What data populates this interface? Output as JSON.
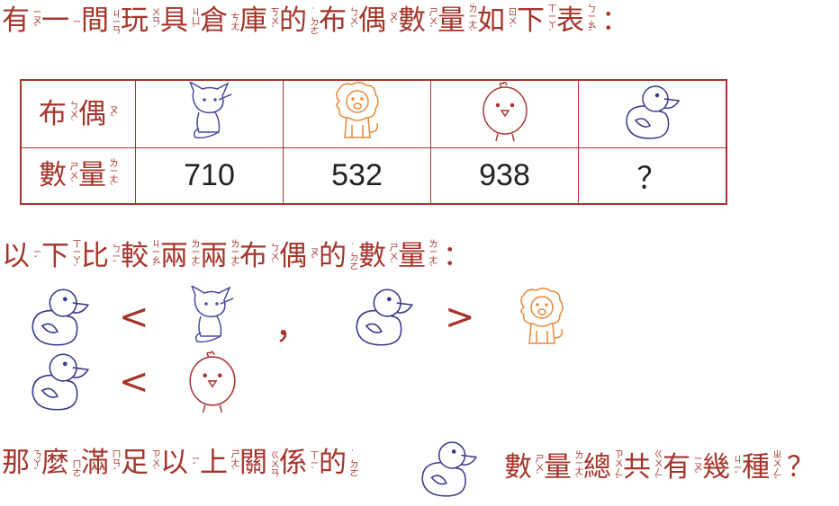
{
  "colors": {
    "text": "#a5352b",
    "fox": "#4a4a9e",
    "lion": "#e8883a",
    "chick": "#a83838",
    "duck": "#3a3a8c"
  },
  "question_line": [
    {
      "c": "有",
      "z": "ㄧㄡˇ"
    },
    {
      "c": "一",
      "z": "ㄧ"
    },
    {
      "c": "間",
      "z": "ㄐㄧㄢ"
    },
    {
      "c": "玩",
      "z": "ㄨㄢˊ"
    },
    {
      "c": "具",
      "z": "ㄐㄩˋ"
    },
    {
      "c": "倉",
      "z": "ㄘㄤ"
    },
    {
      "c": "庫",
      "z": "ㄎㄨˋ"
    },
    {
      "c": "的",
      "z": "˙ㄉㄜ"
    },
    {
      "c": "布",
      "z": "ㄅㄨˋ"
    },
    {
      "c": "偶",
      "z": "ㄡˇ"
    },
    {
      "c": "數",
      "z": "ㄕㄨˋ"
    },
    {
      "c": "量",
      "z": "ㄌㄧㄤˋ"
    },
    {
      "c": "如",
      "z": "ㄖㄨˊ"
    },
    {
      "c": "下",
      "z": "ㄒㄧㄚˋ"
    },
    {
      "c": "表",
      "z": "ㄅㄧㄠˇ"
    },
    {
      "c": "：",
      "z": ""
    }
  ],
  "table": {
    "row1_label": [
      {
        "c": "布",
        "z": "ㄅㄨˋ"
      },
      {
        "c": "偶",
        "z": "ㄡˇ"
      }
    ],
    "row2_label": [
      {
        "c": "數",
        "z": "ㄕㄨˋ"
      },
      {
        "c": "量",
        "z": "ㄌㄧㄤˋ"
      }
    ],
    "toys": [
      "fox-icon",
      "lion-icon",
      "chick-icon",
      "duck-icon"
    ],
    "counts": [
      "710",
      "532",
      "938",
      "？"
    ]
  },
  "compare_line": [
    {
      "c": "以",
      "z": "ㄧˇ"
    },
    {
      "c": "下",
      "z": "ㄒㄧㄚˋ"
    },
    {
      "c": "比",
      "z": "ㄅㄧˇ"
    },
    {
      "c": "較",
      "z": "ㄐㄧㄠˋ"
    },
    {
      "c": "兩",
      "z": "ㄌㄧㄤˇ"
    },
    {
      "c": "兩",
      "z": "ㄌㄧㄤˇ"
    },
    {
      "c": "布",
      "z": "ㄅㄨˋ"
    },
    {
      "c": "偶",
      "z": "ㄡˇ"
    },
    {
      "c": "的",
      "z": "˙ㄉㄜ"
    },
    {
      "c": "數",
      "z": "ㄕㄨˋ"
    },
    {
      "c": "量",
      "z": "ㄌㄧㄤˋ"
    },
    {
      "c": "：",
      "z": ""
    }
  ],
  "comparisons": {
    "less": "<",
    "greater": ">",
    "comma": "，"
  },
  "final_line_a": [
    {
      "c": "那",
      "z": "ㄋㄚˇ"
    },
    {
      "c": "麼",
      "z": "˙ㄇㄜ"
    },
    {
      "c": "滿",
      "z": "ㄇㄢˇ"
    },
    {
      "c": "足",
      "z": "ㄗㄨˊ"
    },
    {
      "c": "以",
      "z": "ㄧˇ"
    },
    {
      "c": "上",
      "z": "ㄕㄤˋ"
    },
    {
      "c": "關",
      "z": "ㄍㄨㄢ"
    },
    {
      "c": "係",
      "z": "ㄒㄧˋ"
    },
    {
      "c": "的",
      "z": "˙ㄉㄜ"
    }
  ],
  "final_line_b": [
    {
      "c": "數",
      "z": "ㄕㄨˋ"
    },
    {
      "c": "量",
      "z": "ㄌㄧㄤˋ"
    },
    {
      "c": "總",
      "z": "ㄗㄨㄥˇ"
    },
    {
      "c": "共",
      "z": "ㄍㄨㄥˋ"
    },
    {
      "c": "有",
      "z": "ㄧㄡˇ"
    },
    {
      "c": "幾",
      "z": "ㄐㄧˇ"
    },
    {
      "c": "種",
      "z": "ㄓㄨㄥˇ"
    },
    {
      "c": "？",
      "z": ""
    }
  ]
}
